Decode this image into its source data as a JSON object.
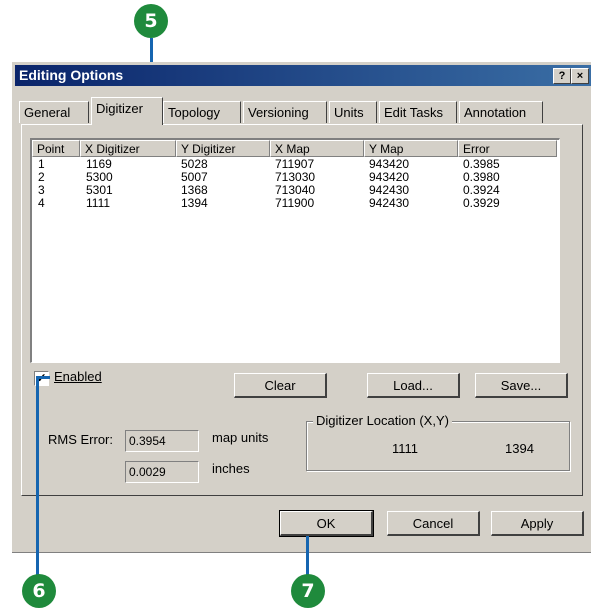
{
  "callouts": [
    "5",
    "6",
    "7"
  ],
  "window": {
    "title": "Editing Options",
    "help_button": "?",
    "close_button": "×"
  },
  "tabs": [
    {
      "label": "General",
      "active": false
    },
    {
      "label": "Digitizer",
      "active": true
    },
    {
      "label": "Topology",
      "active": false
    },
    {
      "label": "Versioning",
      "active": false
    },
    {
      "label": "Units",
      "active": false
    },
    {
      "label": "Edit Tasks",
      "active": false
    },
    {
      "label": "Annotation",
      "active": false
    }
  ],
  "table": {
    "columns": [
      "Point",
      "X Digitizer",
      "Y Digitizer",
      "X Map",
      "Y Map",
      "Error"
    ],
    "rows": [
      [
        "1",
        "1169",
        "5028",
        "711907",
        "943420",
        "0.3985"
      ],
      [
        "2",
        "5300",
        "5007",
        "713030",
        "943420",
        "0.3980"
      ],
      [
        "3",
        "5301",
        "1368",
        "713040",
        "942430",
        "0.3924"
      ],
      [
        "4",
        "1111",
        "1394",
        "711900",
        "942430",
        "0.3929"
      ]
    ]
  },
  "enabled": {
    "label": "Enabled",
    "checked": true,
    "mark": "✓"
  },
  "buttons": {
    "clear": "Clear",
    "load": "Load...",
    "save": "Save...",
    "ok": "OK",
    "cancel": "Cancel",
    "apply": "Apply"
  },
  "rms": {
    "label": "RMS Error:",
    "map_value": "0.3954",
    "map_unit": "map units",
    "inch_value": "0.0029",
    "inch_unit": "inches"
  },
  "location": {
    "title": "Digitizer Location (X,Y)",
    "x": "1111",
    "y": "1394"
  }
}
